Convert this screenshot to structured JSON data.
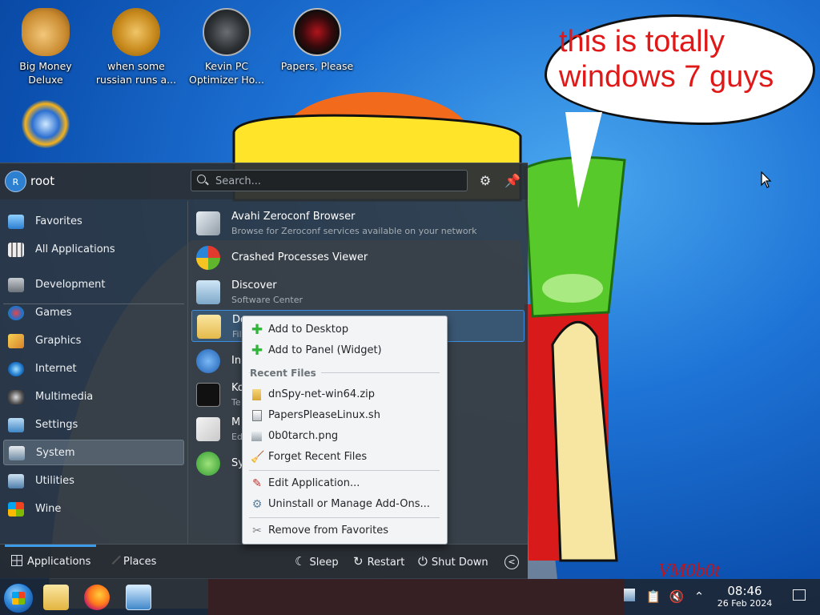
{
  "wallpaper": {
    "speech_bubble": "this is totally windows 7 guys",
    "signature": "VM0b0t"
  },
  "desktop_icons": [
    {
      "label": "Big Money Deluxe",
      "icon": "money-bag-icon"
    },
    {
      "label": "when some russian runs a...",
      "icon": "gear-icon"
    },
    {
      "label": "Kevin PC Optimizer Ho...",
      "icon": "speedometer-icon"
    },
    {
      "label": "Papers, Please",
      "icon": "emblem-icon"
    },
    {
      "label": "",
      "icon": "sun-globe-icon"
    }
  ],
  "launcher": {
    "user": {
      "avatar_letter": "R",
      "name": "root"
    },
    "search_placeholder": "Search...",
    "categories": [
      {
        "label": "Favorites",
        "icon": "favorites-icon"
      },
      {
        "label": "All Applications",
        "icon": "all-apps-icon"
      },
      {
        "label": "Development",
        "icon": "development-icon"
      },
      {
        "label": "Games",
        "icon": "games-icon"
      },
      {
        "label": "Graphics",
        "icon": "graphics-icon"
      },
      {
        "label": "Internet",
        "icon": "internet-icon"
      },
      {
        "label": "Multimedia",
        "icon": "multimedia-icon"
      },
      {
        "label": "Settings",
        "icon": "settings-icon"
      },
      {
        "label": "System",
        "icon": "system-icon",
        "selected": true
      },
      {
        "label": "Utilities",
        "icon": "utilities-icon"
      },
      {
        "label": "Wine",
        "icon": "wine-icon"
      }
    ],
    "apps": [
      {
        "name": "Avahi Zeroconf Browser",
        "desc": "Browse for Zeroconf services available on your network"
      },
      {
        "name": "Crashed Processes Viewer",
        "desc": ""
      },
      {
        "name": "Discover",
        "desc": "Software Center"
      },
      {
        "name": "Do",
        "desc": "Fil"
      },
      {
        "name": "In",
        "desc": ""
      },
      {
        "name": "Ko",
        "desc": "Te"
      },
      {
        "name": "M",
        "desc": "Ed"
      },
      {
        "name": "Sy",
        "desc": ""
      }
    ],
    "footer": {
      "tab_applications": "Applications",
      "tab_places": "Places",
      "sleep": "Sleep",
      "restart": "Restart",
      "shutdown": "Shut Down"
    }
  },
  "context_menu": {
    "add_to_desktop": "Add to Desktop",
    "add_to_panel": "Add to Panel (Widget)",
    "recent_files_header": "Recent Files",
    "recent_files": [
      "dnSpy-net-win64.zip",
      "PapersPleaseLinux.sh",
      "0b0tarch.png"
    ],
    "forget_recent": "Forget Recent Files",
    "edit_application": "Edit Application...",
    "uninstall": "Uninstall or Manage Add-Ons...",
    "remove_favorites": "Remove from Favorites"
  },
  "taskbar": {
    "clock_time": "08:46",
    "clock_date": "26 Feb 2024"
  }
}
